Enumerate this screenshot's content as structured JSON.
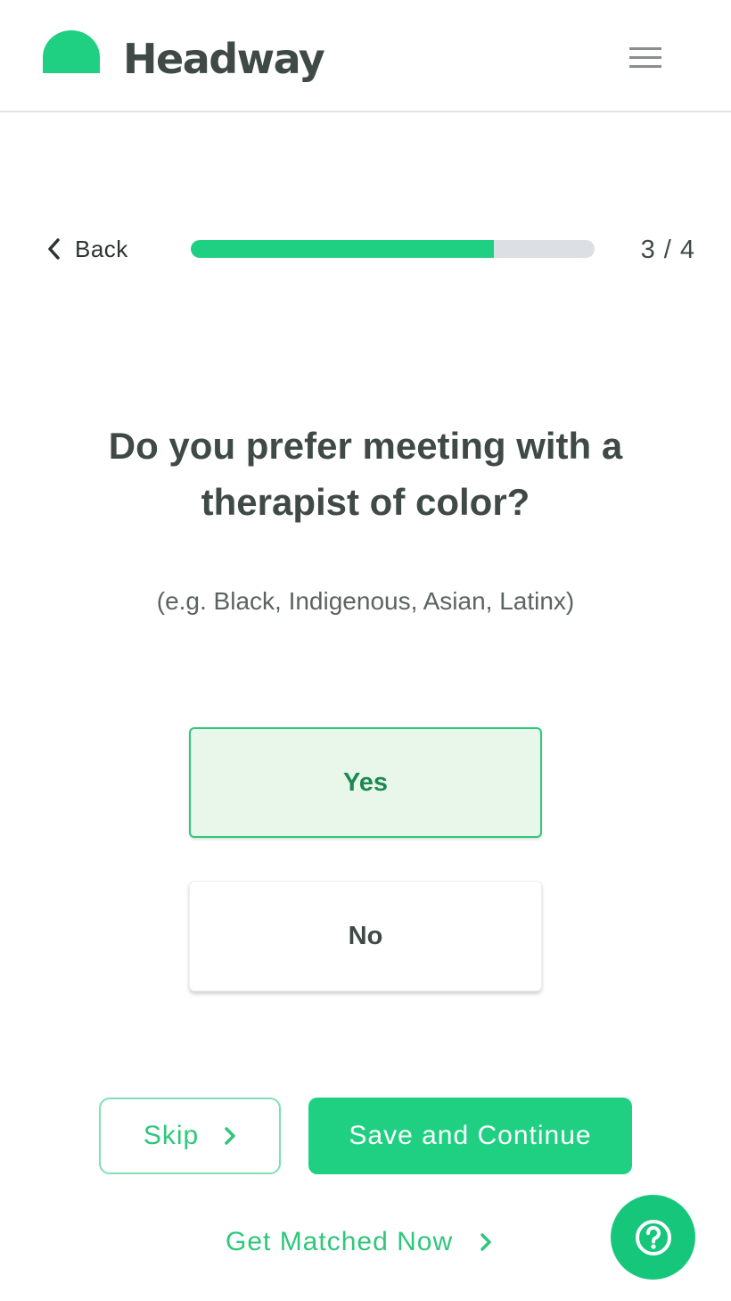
{
  "brand": {
    "name": "Headway",
    "color": "#1fd082",
    "logo_icon": "half-circle-logo"
  },
  "header": {
    "menu_icon": "hamburger-menu-icon"
  },
  "progress": {
    "back_label": "Back",
    "step_text": "3 / 4",
    "fraction": 0.75
  },
  "question": {
    "title": "Do you prefer meeting with a therapist of color?",
    "hint": "(e.g. Black, Indigenous, Asian, Latinx)"
  },
  "options": [
    {
      "label": "Yes",
      "selected": true
    },
    {
      "label": "No",
      "selected": false
    }
  ],
  "actions": {
    "skip_label": "Skip",
    "save_label": "Save and Continue",
    "match_label": "Get Matched Now",
    "help_icon": "question-mark-icon"
  },
  "colors": {
    "accent": "#1fd082",
    "selected_bg": "#e9f6ea",
    "text": "#3f4a46"
  }
}
